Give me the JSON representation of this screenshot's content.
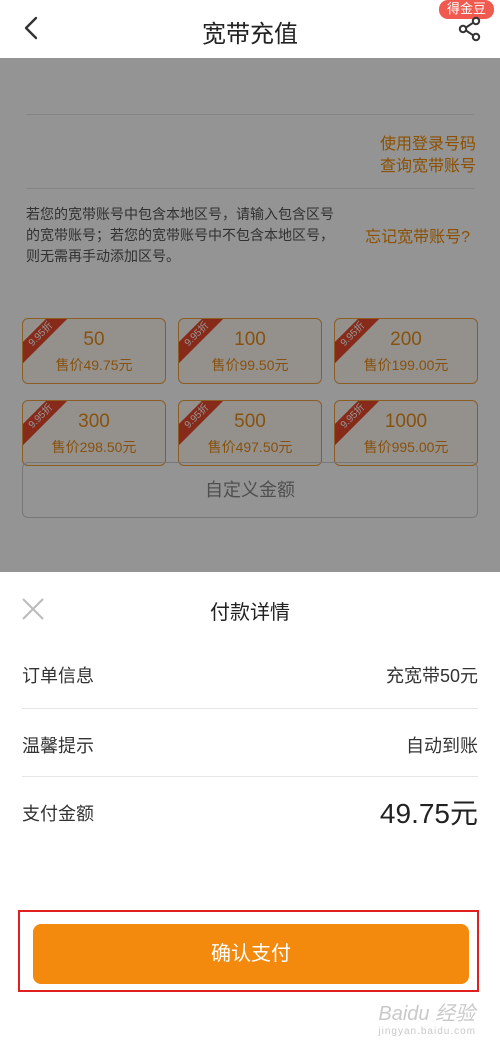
{
  "header": {
    "title": "宽带充值",
    "badge": "得金豆"
  },
  "account": {
    "login_query_line1": "使用登录号码",
    "login_query_line2": "查询宽带账号",
    "hint": "若您的宽带账号中包含本地区号，请输入包含区号的宽带账号；若您的宽带账号中不包含本地区号，则无需再手动添加区号。",
    "forgot": "忘记宽带账号?"
  },
  "options": [
    {
      "amount": "50",
      "price": "售价49.75元",
      "tag": "9.95折"
    },
    {
      "amount": "100",
      "price": "售价99.50元",
      "tag": "9.95折"
    },
    {
      "amount": "200",
      "price": "售价199.00元",
      "tag": "9.95折"
    },
    {
      "amount": "300",
      "price": "售价298.50元",
      "tag": "9.95折"
    },
    {
      "amount": "500",
      "price": "售价497.50元",
      "tag": "9.95折"
    },
    {
      "amount": "1000",
      "price": "售价995.00元",
      "tag": "9.95折"
    }
  ],
  "custom_amount": "自定义金额",
  "payment": {
    "title": "付款详情",
    "order_label": "订单信息",
    "order_value": "充宽带50元",
    "tip_label": "温馨提示",
    "tip_value": "自动到账",
    "amount_label": "支付金额",
    "amount_value": "49.75元",
    "confirm": "确认支付"
  },
  "watermark": {
    "brand": "Baidu 经验",
    "url": "jingyan.baidu.com"
  },
  "colors": {
    "accent": "#f38a0e",
    "highlight_box": "#e02020",
    "discount_tag": "#e8492e"
  },
  "icons": [
    "back-arrow-icon",
    "share-icon",
    "close-icon"
  ]
}
